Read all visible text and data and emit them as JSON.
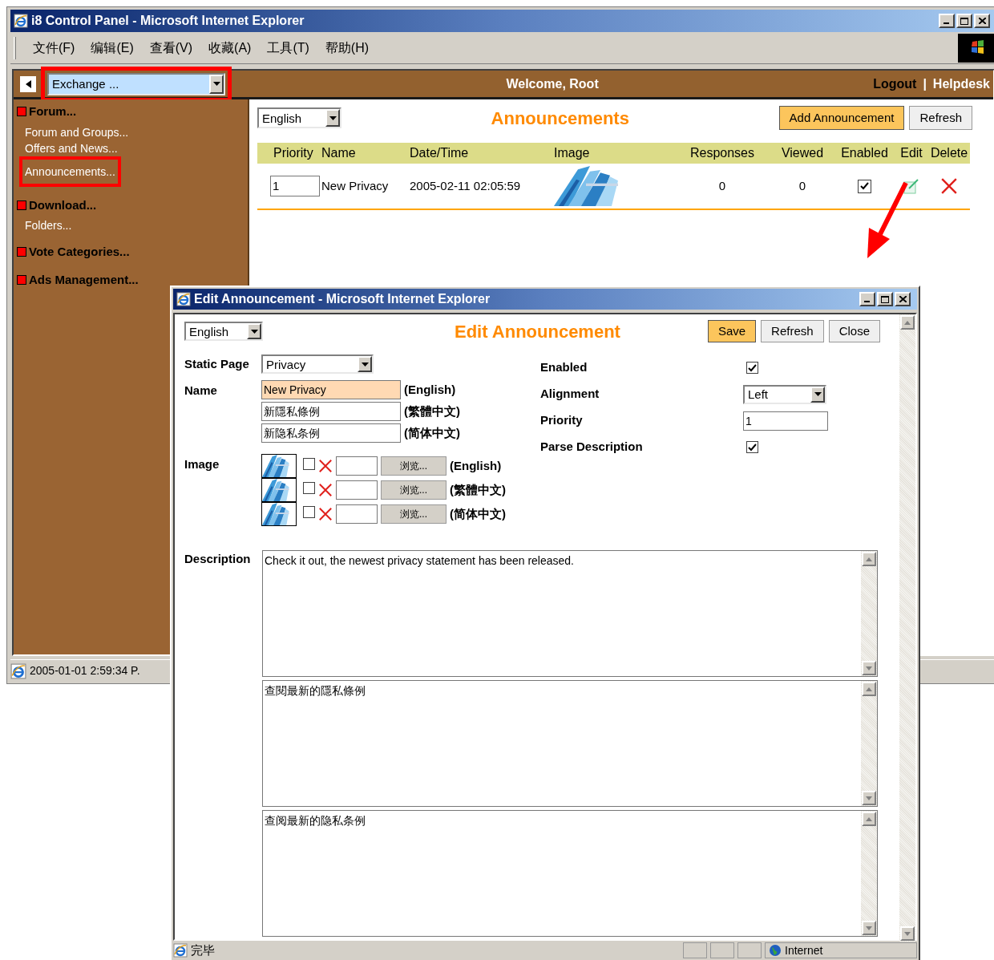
{
  "main_window": {
    "title": "i8 Control Panel - Microsoft Internet Explorer",
    "menu": [
      "文件(F)",
      "编辑(E)",
      "查看(V)",
      "收藏(A)",
      "工具(T)",
      "帮助(H)"
    ],
    "header": {
      "module_select": "Exchange ...",
      "welcome": "Welcome, Root",
      "links": [
        "Logout",
        "Helpdesk"
      ],
      "separator": "|"
    },
    "sidebar": {
      "sections": [
        {
          "label": "Forum...",
          "children": [
            {
              "label": "Forum and Groups...",
              "selected": false
            },
            {
              "label": "Offers and News...",
              "selected": false
            },
            {
              "label": "Announcements...",
              "selected": true
            }
          ]
        },
        {
          "label": "Download...",
          "children": [
            {
              "label": "Folders...",
              "selected": false
            }
          ]
        },
        {
          "label": "Vote Categories..."
        },
        {
          "label": "Ads Management..."
        }
      ]
    },
    "content": {
      "language": "English",
      "title": "Announcements",
      "buttons": [
        {
          "label": "Add Announcement",
          "kind": "primary"
        },
        {
          "label": "Refresh",
          "kind": "normal"
        }
      ],
      "columns": [
        "Priority",
        "Name",
        "Date/Time",
        "Image",
        "Responses",
        "Viewed",
        "Enabled",
        "Edit",
        "Delete"
      ],
      "rows": [
        {
          "priority": "1",
          "name": "New Privacy",
          "datetime": "2005-02-11 02:05:59",
          "responses": "0",
          "viewed": "0",
          "enabled": true
        }
      ]
    },
    "status_bar": {
      "text": "2005-01-01 2:59:34 P."
    }
  },
  "dialog": {
    "title": "Edit Announcement - Microsoft Internet Explorer",
    "language": "English",
    "heading": "Edit Announcement",
    "buttons": [
      {
        "label": "Save",
        "kind": "primary"
      },
      {
        "label": "Refresh",
        "kind": "normal"
      },
      {
        "label": "Close",
        "kind": "normal"
      }
    ],
    "static_page": {
      "label": "Static Page",
      "value": "Privacy"
    },
    "name": {
      "label": "Name",
      "entries": [
        {
          "value": "New Privacy",
          "lang": "(English)",
          "highlighted": true
        },
        {
          "value": "新隱私條例",
          "lang": "(繁體中文)",
          "highlighted": false
        },
        {
          "value": "新隐私条例",
          "lang": "(简体中文)",
          "highlighted": false
        }
      ]
    },
    "image": {
      "label": "Image",
      "entries": [
        {
          "checked": false,
          "browse": "浏览...",
          "lang": "(English)"
        },
        {
          "checked": false,
          "browse": "浏览...",
          "lang": "(繁體中文)"
        },
        {
          "checked": false,
          "browse": "浏览...",
          "lang": "(简体中文)"
        }
      ]
    },
    "settings": [
      {
        "kind": "checkbox",
        "label": "Enabled",
        "checked": true
      },
      {
        "kind": "select",
        "label": "Alignment",
        "value": "Left"
      },
      {
        "kind": "input",
        "label": "Priority",
        "value": "1"
      },
      {
        "kind": "checkbox",
        "label": "Parse Description",
        "checked": true
      }
    ],
    "description": {
      "label": "Description",
      "texts": [
        "Check it out, the newest privacy statement has been released.",
        "查閱最新的隱私條例",
        "查阅最新的隐私条例"
      ]
    },
    "status_bar": {
      "text": "完毕",
      "zone": "Internet"
    }
  }
}
